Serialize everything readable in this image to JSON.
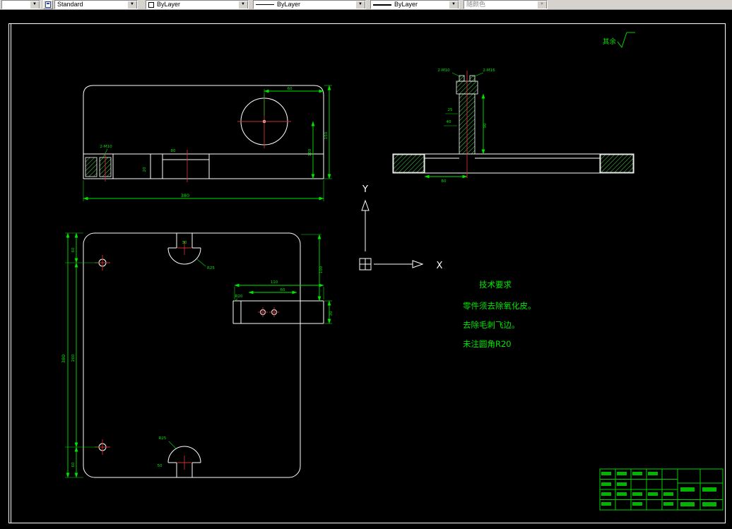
{
  "toolbar": {
    "layer_combo": {
      "value": ""
    },
    "style_combo": {
      "value": "Standard"
    },
    "color_combo": {
      "value": "ByLayer"
    },
    "linetype_combo": {
      "value": "ByLayer"
    },
    "lineweight_combo": {
      "value": "ByLayer"
    },
    "plotstyle_combo": {
      "value": "随颜色"
    }
  },
  "drawing": {
    "surface_note": "其余",
    "ucs": {
      "x_label": "X",
      "y_label": "Y"
    },
    "tech_requirements": {
      "title": "技术要求",
      "lines": [
        "零件须去除氧化皮。",
        "去除毛刺飞边。",
        "未注圆角R20"
      ]
    },
    "front_view": {
      "dims": {
        "circle_offset": "60",
        "overall_height": "150",
        "center_height": "100",
        "overall_width": "380",
        "thread_note": "2-M10",
        "step_width": "80",
        "slot_depth": "20"
      }
    },
    "section_view": {
      "dims": {
        "thread_left": "2-M10",
        "thread_right": "2-M16",
        "boss_top_width": "25",
        "boss_width": "40",
        "boss_height": "90",
        "base_offset": "60"
      }
    },
    "plan_view": {
      "dims": {
        "overall_height": "380",
        "hole_spacing": "260",
        "edge_top": "60",
        "edge_bottom": "60",
        "slot_radius_top": "R25",
        "slot_width_top": "30",
        "slot_radius_bottom": "R25",
        "slot_width_bottom": "50",
        "tab_width": "110",
        "tab_inner": "60",
        "tab_height": "30",
        "tab_fillet": "R20",
        "right_height": "100"
      }
    },
    "colors": {
      "line": "#ffffff",
      "dimension": "#00e400",
      "centerline": "#c83232",
      "background": "#000000"
    }
  }
}
